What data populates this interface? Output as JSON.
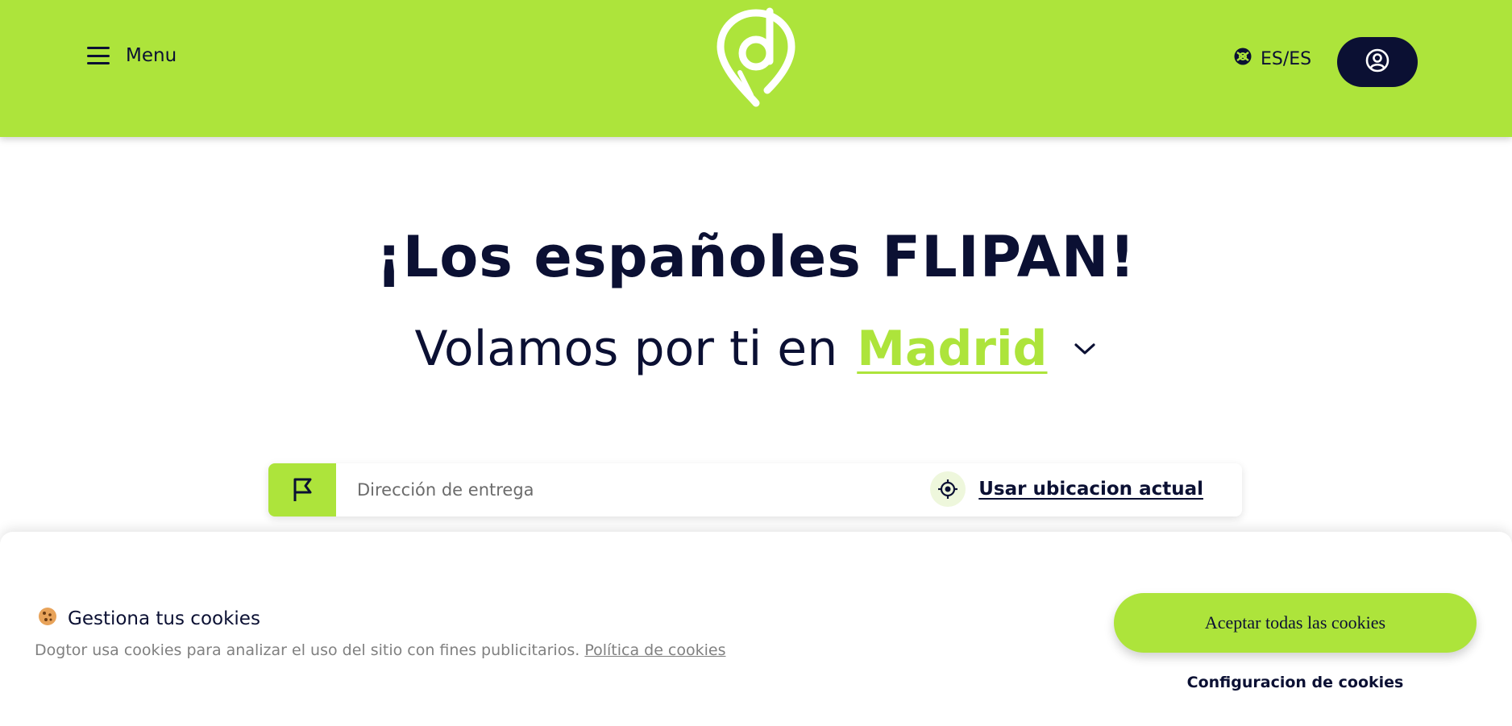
{
  "header": {
    "menu_label": "Menu",
    "language_label": "ES/ES"
  },
  "hero": {
    "title": "¡Los españoles FLIPAN!",
    "subtitle_prefix": "Volamos por ti en",
    "city": "Madrid"
  },
  "address": {
    "placeholder": "Dirección de entrega",
    "use_location_label": "Usar ubicacion actual"
  },
  "cookies": {
    "title": "Gestiona tus cookies",
    "description": "Dogtor usa cookies para analizar el uso del sitio con fines publicitarios.",
    "policy_link": "Política de cookies",
    "accept_label": "Aceptar todas las cookies",
    "config_label": "Configuracion de cookies"
  },
  "colors": {
    "brand_green": "#ade43b",
    "navy": "#0b1033"
  },
  "icons": [
    "hamburger-icon",
    "brand-logo",
    "globe-icon",
    "user-icon",
    "chevron-down-icon",
    "flag-icon",
    "crosshair-icon",
    "cookie-icon"
  ]
}
